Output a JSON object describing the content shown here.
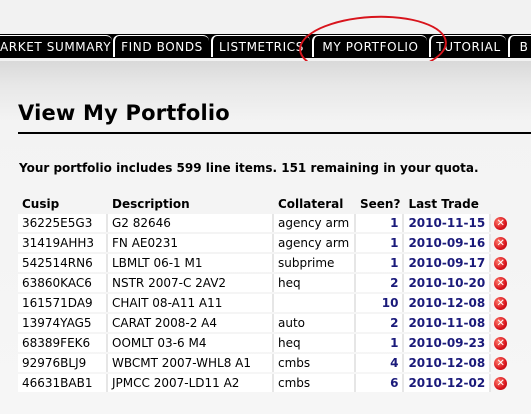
{
  "nav": {
    "tabs": [
      {
        "label": "ARKET SUMMARY"
      },
      {
        "label": "FIND BONDS"
      },
      {
        "label": "LISTMETRICS"
      },
      {
        "label": "MY PORTFOLIO"
      },
      {
        "label": "TUTORIAL"
      },
      {
        "label": "B"
      }
    ]
  },
  "page": {
    "title": "View My Portfolio",
    "quota_text": "Your portfolio includes 599 line items. 151 remaining in your quota."
  },
  "table": {
    "headers": {
      "cusip": "Cusip",
      "description": "Description",
      "collateral": "Collateral",
      "seen": "Seen?",
      "last_trade": "Last Trade"
    },
    "rows": [
      {
        "cusip": "36225E5G3",
        "description": "G2 82646",
        "collateral": "agency arm",
        "seen": "1",
        "last_trade": "2010-11-15"
      },
      {
        "cusip": "31419AHH3",
        "description": "FN AE0231",
        "collateral": "agency arm",
        "seen": "1",
        "last_trade": "2010-09-16"
      },
      {
        "cusip": "542514RN6",
        "description": "LBMLT 06-1 M1",
        "collateral": "subprime",
        "seen": "1",
        "last_trade": "2010-09-17"
      },
      {
        "cusip": "63860KAC6",
        "description": "NSTR 2007-C 2AV2",
        "collateral": "heq",
        "seen": "2",
        "last_trade": "2010-10-20"
      },
      {
        "cusip": "161571DA9",
        "description": "CHAIT 08-A11 A11",
        "collateral": "",
        "seen": "10",
        "last_trade": "2010-12-08"
      },
      {
        "cusip": "13974YAG5",
        "description": "CARAT 2008-2 A4",
        "collateral": "auto",
        "seen": "2",
        "last_trade": "2010-11-08"
      },
      {
        "cusip": "68389FEK6",
        "description": "OOMLT 03-6 M4",
        "collateral": "heq",
        "seen": "1",
        "last_trade": "2010-09-23"
      },
      {
        "cusip": "92976BLJ9",
        "description": "WBCMT 2007-WHL8 A1",
        "collateral": "cmbs",
        "seen": "4",
        "last_trade": "2010-12-08"
      },
      {
        "cusip": "46631BAB1",
        "description": "JPMCC 2007-LD11 A2",
        "collateral": "cmbs",
        "seen": "6",
        "last_trade": "2010-12-02"
      }
    ],
    "delete_icon": "delete-icon"
  },
  "colors": {
    "nav_bg": "#000000",
    "annotation": "#d8141c",
    "link": "#1a1a7a",
    "delete": "#d8141c"
  }
}
